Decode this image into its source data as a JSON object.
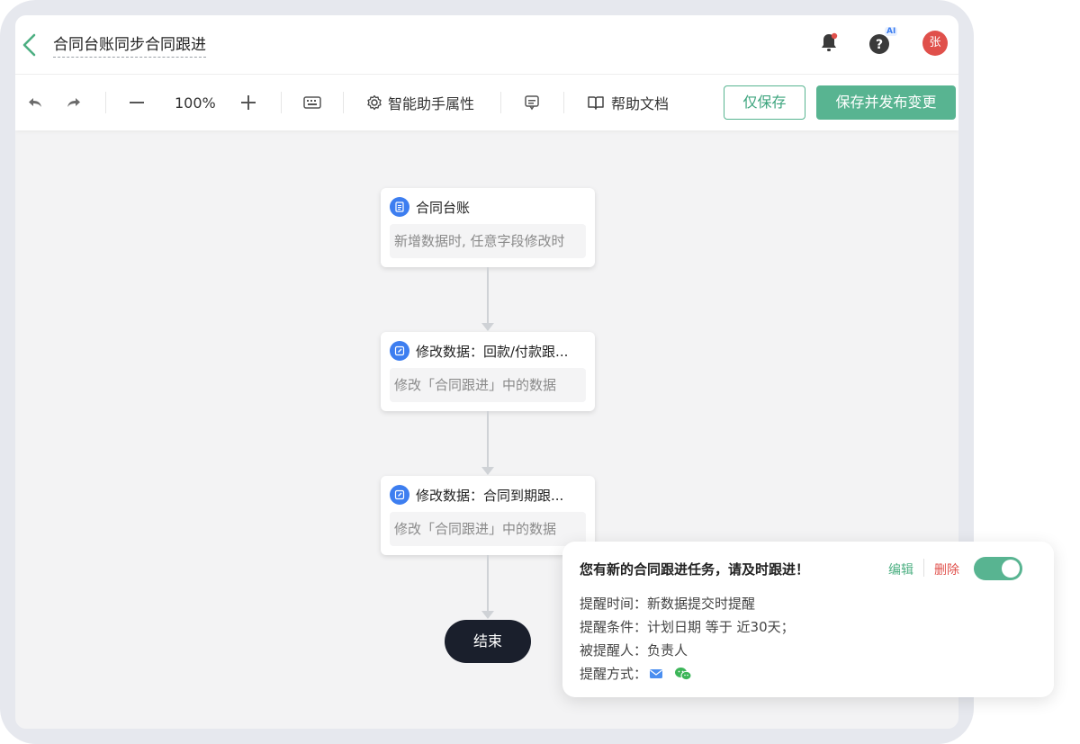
{
  "header": {
    "title": "合同台账同步合同跟进",
    "avatar_text": "张",
    "ai_badge": "AI"
  },
  "toolbar": {
    "zoom": "100%",
    "assistant_label": "智能助手属性",
    "help_docs_label": "帮助文档",
    "save_only_label": "仅保存",
    "save_publish_label": "保存并发布变更"
  },
  "flow": {
    "nodes": [
      {
        "title": "合同台账",
        "desc": "新增数据时, 任意字段修改时",
        "icon": "document-icon"
      },
      {
        "title": "修改数据：回款/付款跟...",
        "desc": "修改「合同跟进」中的数据",
        "icon": "edit-icon"
      },
      {
        "title": "修改数据：合同到期跟...",
        "desc": "修改「合同跟进」中的数据",
        "icon": "edit-icon"
      }
    ],
    "end_label": "结束"
  },
  "popup": {
    "title": "您有新的合同跟进任务，请及时跟进！",
    "edit_label": "编辑",
    "delete_label": "删除",
    "enabled": true,
    "time_row": "提醒时间：新数据提交时提醒",
    "condition_row": "提醒条件：计划日期 等于 近30天；",
    "recipient_row": "被提醒人：负责人",
    "method_label": "提醒方式："
  },
  "colors": {
    "accent": "#58b491",
    "node_icon": "#3d7ef0",
    "end_node": "#1a1f2c",
    "danger": "#e0504b"
  }
}
